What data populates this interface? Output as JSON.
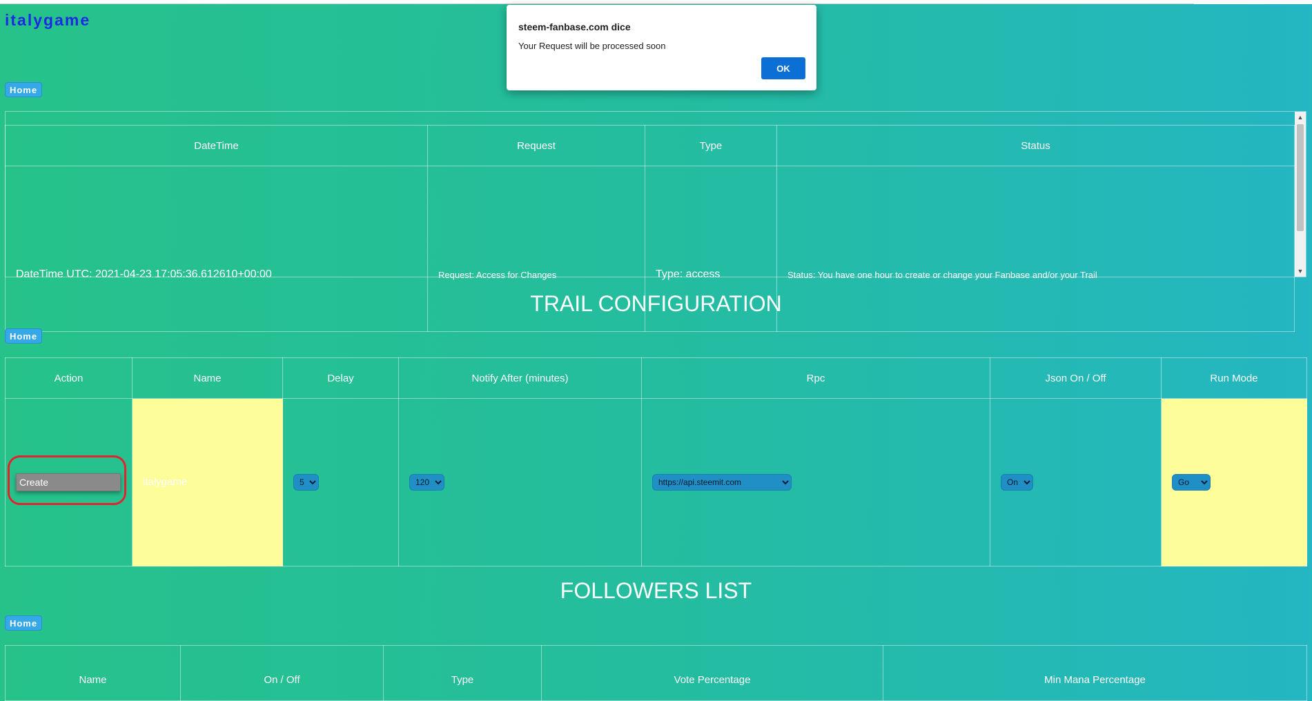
{
  "brand": "italygame",
  "home_label": "Home",
  "dialog": {
    "title": "steem-fanbase.com dice",
    "message": "Your Request will be processed soon",
    "ok_label": "OK"
  },
  "requests_table": {
    "headers": [
      "DateTime",
      "Request",
      "Type",
      "Status"
    ],
    "row": {
      "datetime": "DateTime UTC: 2021-04-23 17:05:36.612610+00:00",
      "request": "Request: Access for Changes",
      "type": "Type: access",
      "status": "Status: You have one hour to create or change your Fanbase and/or your Trail"
    }
  },
  "trail": {
    "title": "TRAIL CONFIGURATION",
    "headers": [
      "Action",
      "Name",
      "Delay",
      "Notify After (minutes)",
      "Rpc",
      "Json On / Off",
      "Run Mode"
    ],
    "create_label": "Create",
    "name_value": "italygame",
    "delay": "5",
    "notify": "120",
    "rpc": "https://api.steemit.com",
    "json": "On",
    "run_mode": "Go"
  },
  "followers": {
    "title": "FOLLOWERS LIST",
    "headers": [
      "Name",
      "On / Off",
      "Type",
      "Vote Percentage",
      "Min Mana Percentage"
    ]
  },
  "colors": {
    "brand": "#1a2be0",
    "accent": "#35a8e8",
    "highlight": "#fdfd9a",
    "annotation": "#e0242f"
  }
}
